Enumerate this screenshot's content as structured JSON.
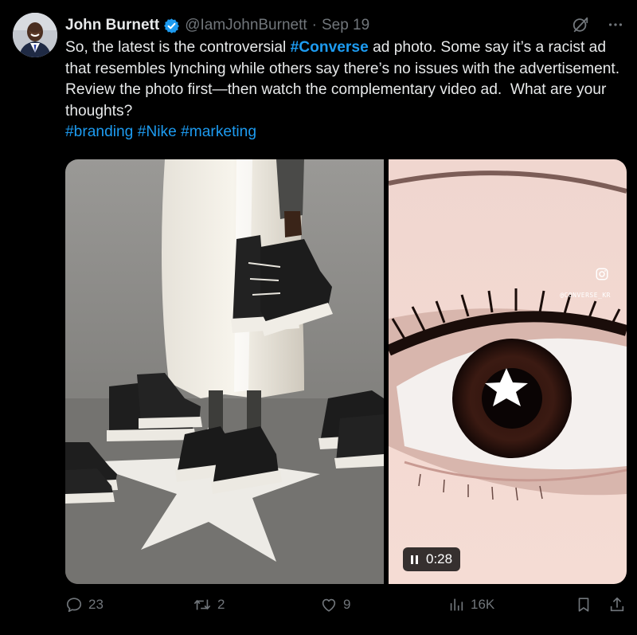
{
  "tweet": {
    "author_name": "John Burnett",
    "handle": "@IamJohnBurnett",
    "separator": "·",
    "date": "Sep 19",
    "text_part1": "So, the latest is the controversial ",
    "hashtag_converse": "#Converse",
    "text_part2": " ad photo. Some say it’s a racist ad that resembles lynching while others say there’s no issues with the advertisement. Review the photo first—then watch the complementary video ad.  What are your thoughts?",
    "hashtags": [
      "#branding",
      "#Nike",
      "#marketing"
    ]
  },
  "media": {
    "video_duration": "0:28",
    "video_watermark": "@CONVERSE_KR"
  },
  "actions": {
    "replies": "23",
    "reposts": "2",
    "likes": "9",
    "views": "16K"
  },
  "colors": {
    "background": "#000000",
    "text": "#e7e9ea",
    "secondary": "#71767b",
    "link": "#1d9bf0",
    "verified": "#1d9bf0"
  },
  "icons": {
    "verified": "verified-badge-icon",
    "grok": "grok-icon",
    "more": "more-icon",
    "reply": "reply-icon",
    "repost": "repost-icon",
    "like": "like-icon",
    "views": "views-icon",
    "bookmark": "bookmark-icon",
    "share": "share-icon",
    "pause": "pause-icon",
    "instagram": "instagram-icon"
  }
}
